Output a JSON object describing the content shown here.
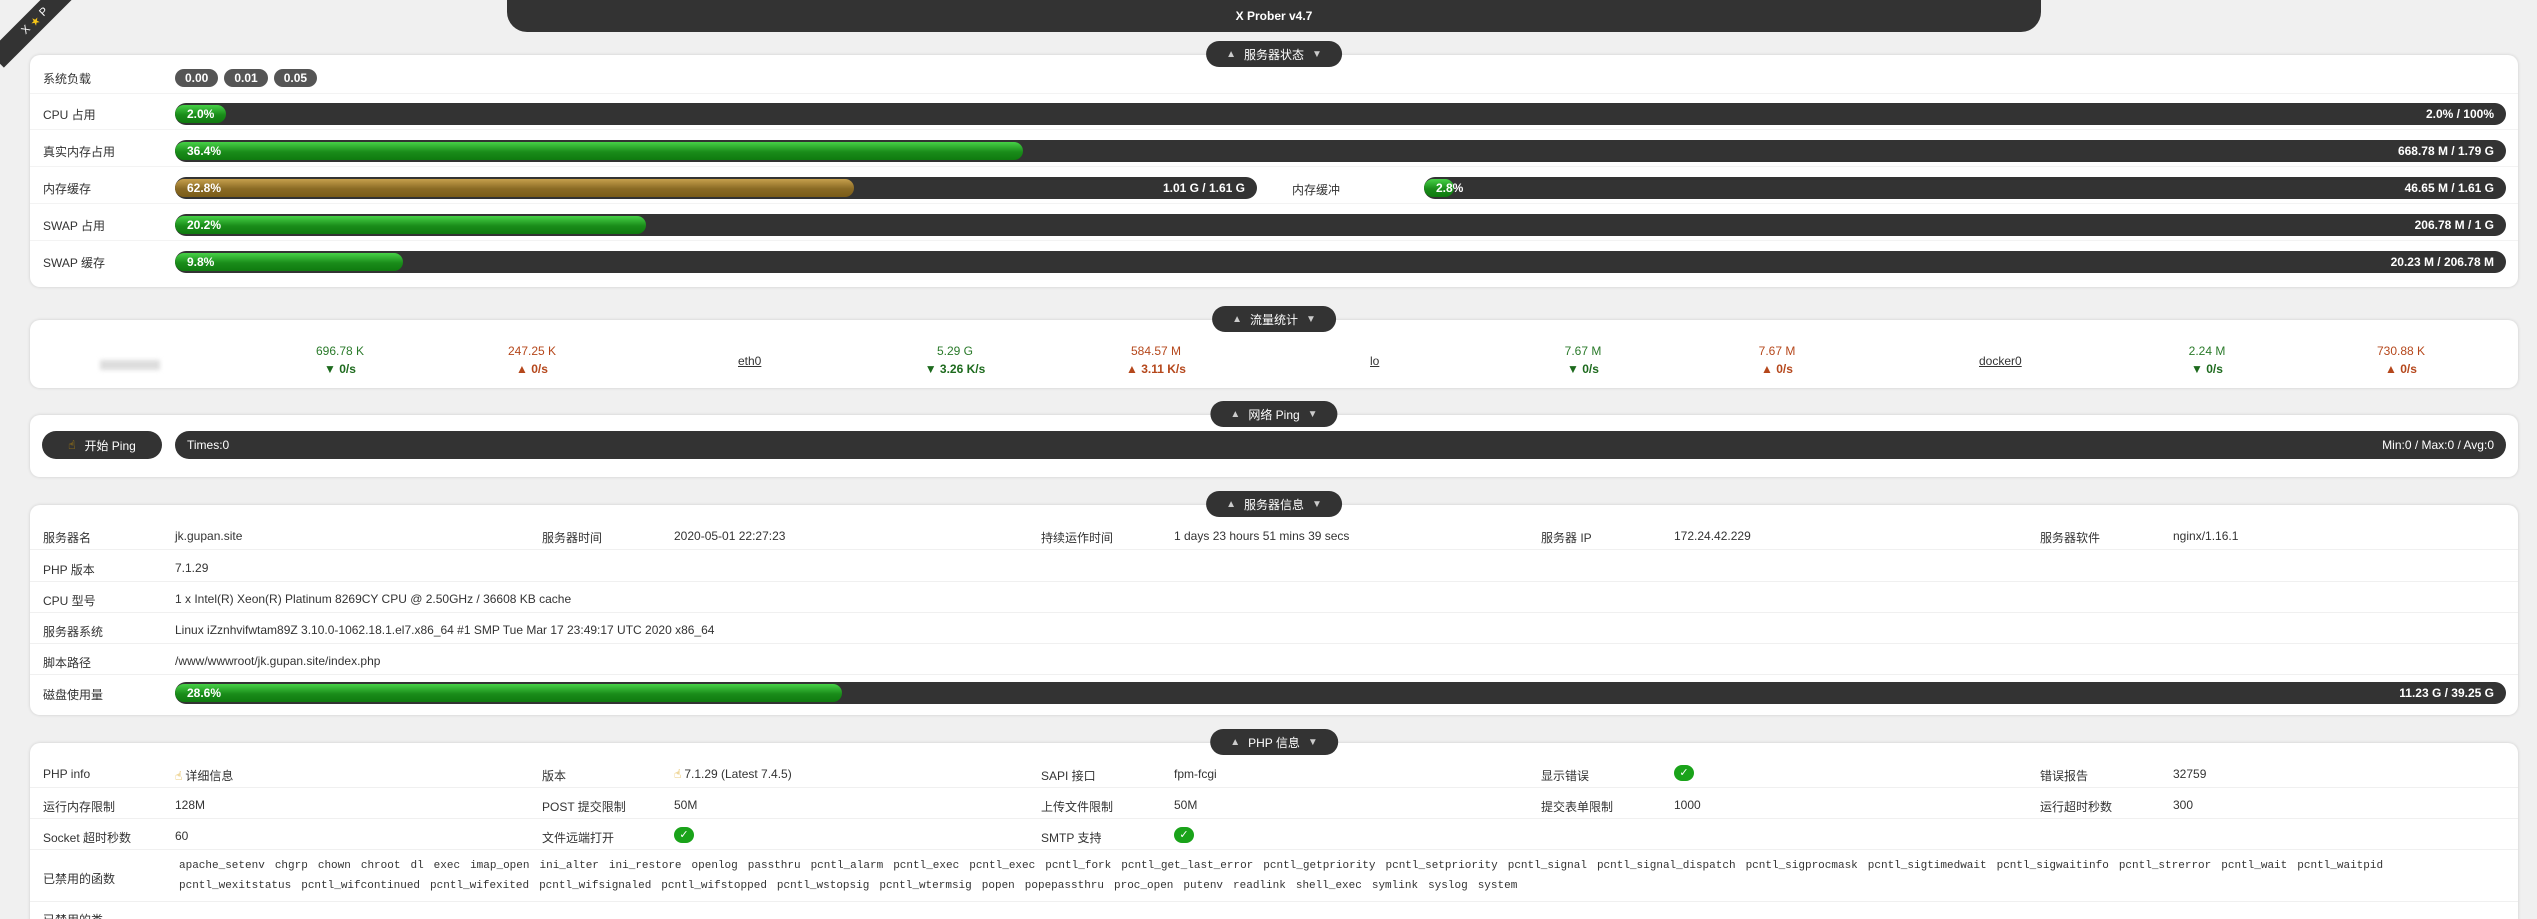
{
  "ribbon": {
    "left": "X",
    "right": "P"
  },
  "app_title": "X Prober v4.7",
  "sections": {
    "server_status": "服务器状态",
    "network": "流量统计",
    "ping": "网络 Ping",
    "server_info": "服务器信息",
    "php_info": "PHP 信息"
  },
  "status": {
    "load_label": "系统负载",
    "load": [
      "0.00",
      "0.01",
      "0.05"
    ],
    "cpu": {
      "label": "CPU 占用",
      "pct": "2.0%",
      "value": "2.0% / 100%",
      "fraction": 0.02
    },
    "mem_real": {
      "label": "真实内存占用",
      "pct": "36.4%",
      "value": "668.78 M / 1.79 G",
      "fraction": 0.364
    },
    "mem_cache": {
      "label": "内存缓存",
      "pct": "62.8%",
      "value": "1.01 G / 1.61 G",
      "fraction": 0.628
    },
    "mem_buffer": {
      "label": "内存缓冲",
      "pct": "2.8%",
      "value": "46.65 M / 1.61 G",
      "fraction": 0.028
    },
    "swap_used": {
      "label": "SWAP 占用",
      "pct": "20.2%",
      "value": "206.78 M / 1 G",
      "fraction": 0.202
    },
    "swap_cache": {
      "label": "SWAP 缓存",
      "pct": "9.8%",
      "value": "20.23 M / 206.78 M",
      "fraction": 0.098
    }
  },
  "network": {
    "interfaces": [
      {
        "name": "",
        "rx_total": "696.78 K",
        "rx_rate": "▼ 0/s",
        "tx_total": "247.25 K",
        "tx_rate": "▲ 0/s"
      },
      {
        "name": "eth0",
        "rx_total": "5.29 G",
        "rx_rate": "▼ 3.26 K/s",
        "tx_total": "584.57 M",
        "tx_rate": "▲ 3.11 K/s"
      },
      {
        "name": "lo",
        "rx_total": "7.67 M",
        "rx_rate": "▼ 0/s",
        "tx_total": "7.67 M",
        "tx_rate": "▲ 0/s"
      },
      {
        "name": "docker0",
        "rx_total": "2.24 M",
        "rx_rate": "▼ 0/s",
        "tx_total": "730.88 K",
        "tx_rate": "▲ 0/s"
      }
    ]
  },
  "ping": {
    "button": "开始 Ping",
    "times": "Times:0",
    "stats": "Min:0 / Max:0 / Avg:0"
  },
  "server_info": {
    "server_name_label": "服务器名",
    "server_name": "jk.gupan.site",
    "time_label": "服务器时间",
    "time": "2020-05-01 22:27:23",
    "uptime_label": "持续运作时间",
    "uptime": "1 days 23 hours 51 mins 39 secs",
    "ip_label": "服务器 IP",
    "ip": "172.24.42.229",
    "software_label": "服务器软件",
    "software": "nginx/1.16.1",
    "php_label": "PHP 版本",
    "php": "7.1.29",
    "cpu_label": "CPU 型号",
    "cpu": "1 x Intel(R) Xeon(R) Platinum 8269CY CPU @ 2.50GHz / 36608 KB cache",
    "os_label": "服务器系统",
    "os": "Linux iZznhvifwtam89Z 3.10.0-1062.18.1.el7.x86_64 #1 SMP Tue Mar 17 23:49:17 UTC 2020 x86_64",
    "path_label": "脚本路径",
    "path": "/www/wwwroot/jk.gupan.site/index.php",
    "disk_label": "磁盘使用量",
    "disk_pct": "28.6%",
    "disk_value": "11.23 G / 39.25 G",
    "disk_fraction": 0.286
  },
  "php": {
    "phpinfo_label": "PHP info",
    "phpinfo": "详细信息",
    "version_label": "版本",
    "version": "7.1.29 (Latest 7.4.5)",
    "sapi_label": "SAPI 接口",
    "sapi": "fpm-fcgi",
    "display_errors_label": "显示错误",
    "error_report_label": "错误报告",
    "error_report": "32759",
    "mem_limit_label": "运行内存限制",
    "mem_limit": "128M",
    "post_max_label": "POST 提交限制",
    "post_max": "50M",
    "upload_max_label": "上传文件限制",
    "upload_max": "50M",
    "max_input_label": "提交表单限制",
    "max_input": "1000",
    "max_exec_label": "运行超时秒数",
    "max_exec": "300",
    "socket_label": "Socket 超时秒数",
    "socket": "60",
    "url_fopen_label": "文件远端打开",
    "smtp_label": "SMTP 支持",
    "check_mark": "✓",
    "disabled_label": "已禁用的函数",
    "disabled_functions": [
      "apache_setenv",
      "chgrp",
      "chown",
      "chroot",
      "dl",
      "exec",
      "imap_open",
      "ini_alter",
      "ini_restore",
      "openlog",
      "passthru",
      "pcntl_alarm",
      "pcntl_exec",
      "pcntl_exec",
      "pcntl_fork",
      "pcntl_get_last_error",
      "pcntl_getpriority",
      "pcntl_setpriority",
      "pcntl_signal",
      "pcntl_signal_dispatch",
      "pcntl_sigprocmask",
      "pcntl_sigtimedwait",
      "pcntl_sigwaitinfo",
      "pcntl_strerror",
      "pcntl_wait",
      "pcntl_waitpid",
      "pcntl_wexitstatus",
      "pcntl_wifcontinued",
      "pcntl_wifexited",
      "pcntl_wifsignaled",
      "pcntl_wifstopped",
      "pcntl_wstopsig",
      "pcntl_wtermsig",
      "popen",
      "popepassthru",
      "proc_open",
      "putenv",
      "readlink",
      "shell_exec",
      "symlink",
      "syslog",
      "system"
    ],
    "disabled_classes_label": "已禁用的类"
  }
}
